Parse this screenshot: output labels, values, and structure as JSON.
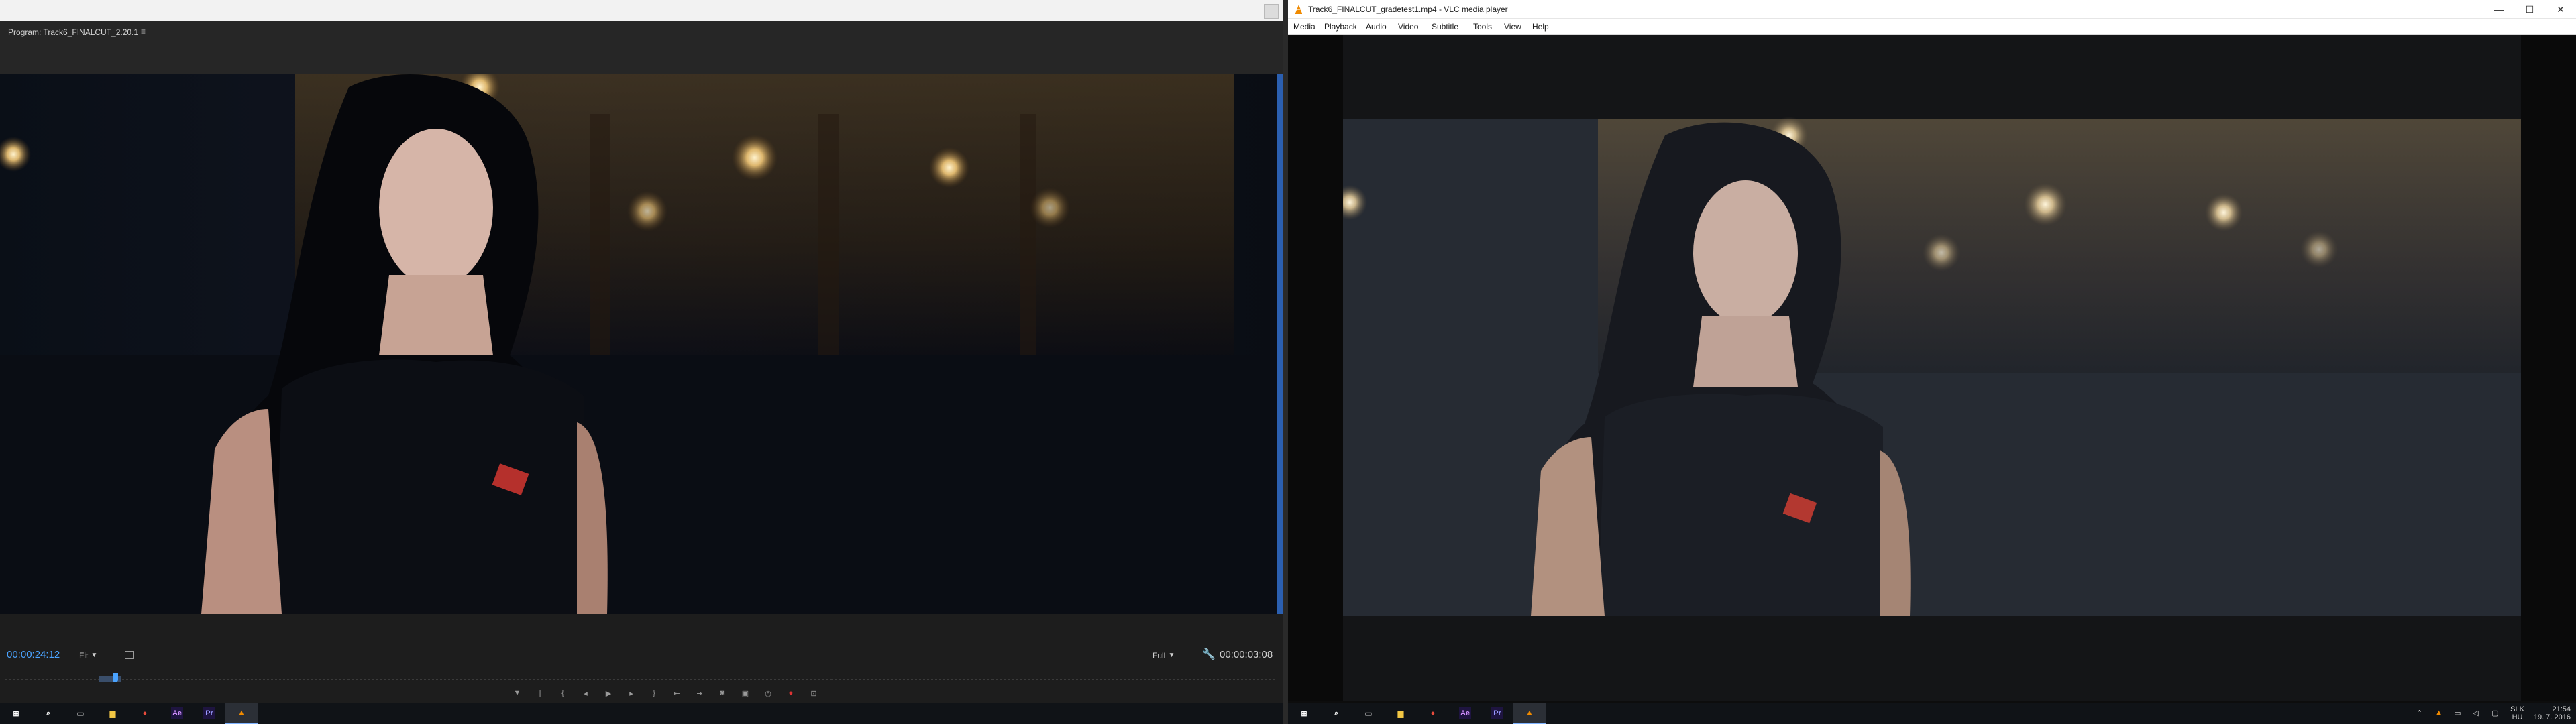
{
  "premiere": {
    "panel_title": "Program: Track6_FINALCUT_2.20.1",
    "panel_menu_icon": "≡",
    "timecode_current": "00:00:24:12",
    "fit_label": "Fit",
    "full_label": "Full",
    "timecode_duration": "00:00:03:08",
    "transport_icons": [
      "mark-in-icon",
      "mark-out-icon",
      "go-to-in-icon",
      "step-back-icon",
      "play-icon",
      "step-forward-icon",
      "go-to-out-icon",
      "insert-icon",
      "overwrite-icon",
      "export-frame-icon",
      "comparison-view-icon",
      "vr-icon",
      "record-icon",
      "toggle-proxies-icon",
      "settings-icon"
    ]
  },
  "vlc": {
    "window_title": "Track6_FINALCUT_gradetest1.mp4 - VLC media player",
    "menu": [
      "Media",
      "Playback",
      "Audio",
      "Video",
      "Subtitle",
      "Tools",
      "View",
      "Help"
    ],
    "minimize": "—",
    "maximize": "☐",
    "close": "✕"
  },
  "taskbar": {
    "apps": [
      {
        "name": "start-icon",
        "label": "⊞"
      },
      {
        "name": "search-icon",
        "label": "⌕"
      },
      {
        "name": "task-view-icon",
        "label": "▭"
      },
      {
        "name": "file-explorer-icon",
        "label": "▆"
      },
      {
        "name": "chrome-icon",
        "label": "●"
      },
      {
        "name": "after-effects-icon",
        "label": "Ae"
      },
      {
        "name": "premiere-icon",
        "label": "Pr"
      },
      {
        "name": "vlc-icon",
        "label": "▲"
      }
    ],
    "lang_top": "SLK",
    "lang_bottom": "HU",
    "time": "21:54",
    "date": "19. 7. 2016"
  },
  "colors": {
    "premiere_accent": "#4aa3ff",
    "vlc_orange": "#f08a00",
    "ae_purple": "#d291ff",
    "pr_purple": "#9999ff"
  }
}
